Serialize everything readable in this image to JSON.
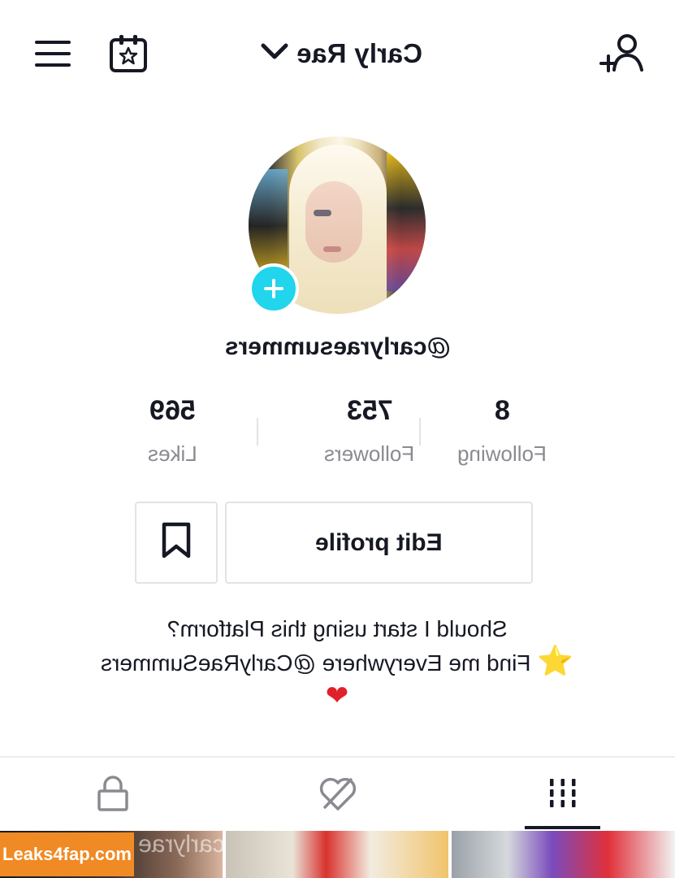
{
  "header": {
    "account_name": "Carly Rae",
    "icons": {
      "menu": "hamburger-menu-icon",
      "calendar": "calendar-star-icon",
      "add_user": "add-user-icon",
      "dropdown": "chevron-down-icon"
    }
  },
  "profile": {
    "username": "@carlyraesummers",
    "avatar_add_icon": "plus-icon",
    "accent_color": "#20d5ec"
  },
  "stats": {
    "likes": {
      "value": "569",
      "label": "Likes"
    },
    "followers": {
      "value": "753",
      "label": "Followers"
    },
    "following": {
      "value": "8",
      "label": "Following"
    }
  },
  "actions": {
    "edit_profile_label": "Edit profile",
    "bookmark_icon": "bookmark-icon"
  },
  "bio": {
    "line1": "Should I start using this Platform?",
    "line2": "Find me Everywhere @CarlyRaeSummers",
    "line2_emoji": "⭐",
    "line3_emoji": "❤"
  },
  "tabs": [
    {
      "name": "videos",
      "icon": "grid-icon",
      "active": true
    },
    {
      "name": "liked",
      "icon": "liked-hidden-icon",
      "active": false
    },
    {
      "name": "private",
      "icon": "lock-icon",
      "active": false
    }
  ],
  "grid": {
    "thumb1_caption": "carlyrae"
  },
  "watermark": {
    "text": "Leaks4fap.com",
    "color": "#f08a24"
  }
}
